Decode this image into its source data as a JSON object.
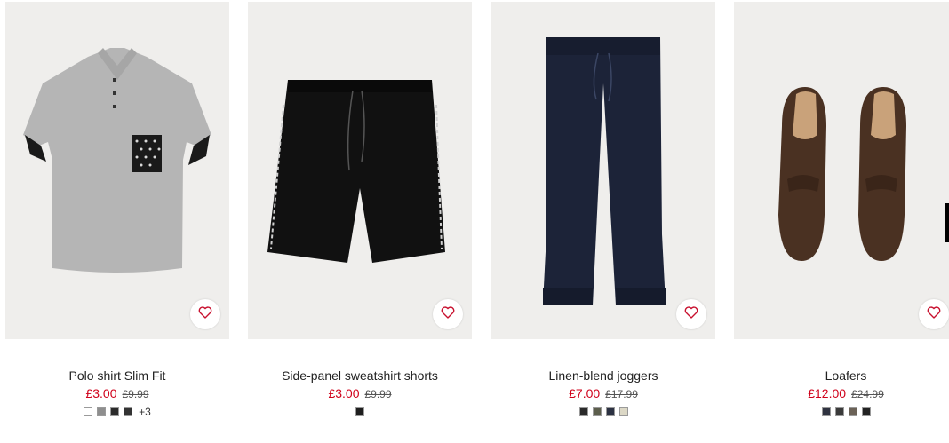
{
  "products": [
    {
      "title": "Polo shirt Slim Fit",
      "price_now": "£3.00",
      "price_was": "£9.99",
      "swatches": [
        "#ffffff",
        "#8e8e8e",
        "#2b2b2b",
        "#333333"
      ],
      "more": "+3",
      "favorite_icon": "heart-icon"
    },
    {
      "title": "Side-panel sweatshirt shorts",
      "price_now": "£3.00",
      "price_was": "£9.99",
      "swatches": [
        "#1e1e1e"
      ],
      "more": "",
      "favorite_icon": "heart-icon"
    },
    {
      "title": "Linen-blend joggers",
      "price_now": "£7.00",
      "price_was": "£17.99",
      "swatches": [
        "#2a2a2a",
        "#5c5e4c",
        "#2b3142",
        "#dcd8c6"
      ],
      "more": "",
      "favorite_icon": "heart-icon"
    },
    {
      "title": "Loafers",
      "price_now": "£12.00",
      "price_was": "£24.99",
      "swatches": [
        "#2f3340",
        "#3a3a3a",
        "#6b6257",
        "#222222"
      ],
      "more": "",
      "favorite_icon": "heart-icon"
    }
  ],
  "colors": {
    "sale_price": "#d0021b",
    "heart": "#c8102e",
    "image_bg": "#efeeec"
  }
}
